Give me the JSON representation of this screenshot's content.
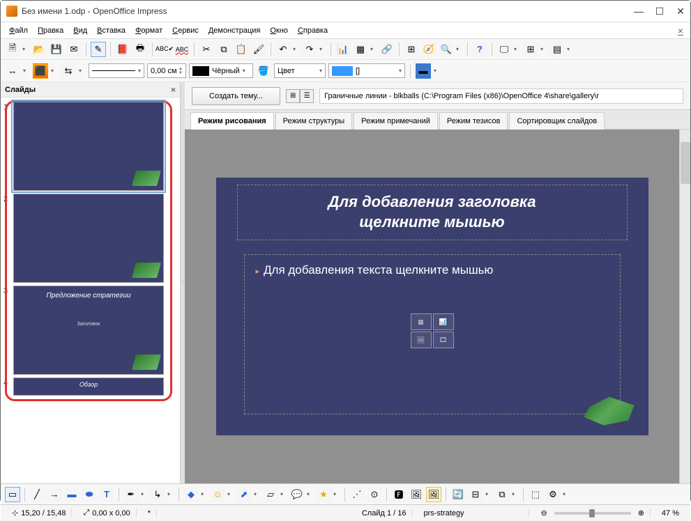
{
  "window": {
    "title": "Без имени 1.odp - OpenOffice Impress"
  },
  "menu": {
    "file": "Файл",
    "edit": "Правка",
    "view": "Вид",
    "insert": "Вставка",
    "format": "Формат",
    "tools": "Сервис",
    "slideshow": "Демонстрация",
    "window": "Окно",
    "help": "Справка"
  },
  "toolbar2": {
    "line_width": "0,00 см",
    "fill_color_label": "Чёрный",
    "fill_type": "Цвет",
    "fill_brackets": "[]"
  },
  "slidepanel": {
    "title": "Слайды",
    "slides": [
      {
        "num": "1",
        "title": "",
        "body": ""
      },
      {
        "num": "2",
        "title": "",
        "body": ""
      },
      {
        "num": "3",
        "title": "Предложение стратегии",
        "body": "Заголовок"
      },
      {
        "num": "4",
        "title": "Обзор",
        "body": ""
      }
    ]
  },
  "themebar": {
    "button": "Создать тему...",
    "path": "Граничные линии - blkballs (C:\\Program Files (x86)\\OpenOffice 4\\share\\gallery\\r"
  },
  "tabs": {
    "drawing": "Режим рисования",
    "outline": "Режим структуры",
    "notes": "Режим примечаний",
    "handout": "Режим тезисов",
    "sorter": "Сортировщик слайдов"
  },
  "slide": {
    "title": "Для добавления заголовка\nщелкните мышью",
    "body": "Для добавления текста щелкните мышью"
  },
  "status": {
    "coords": "15,20 / 15,48",
    "size": "0,00 x 0,00",
    "star": "*",
    "slide_of": "Слайд 1 / 16",
    "template": "prs-strategy",
    "zoom": "47 %"
  },
  "chart_data": null
}
